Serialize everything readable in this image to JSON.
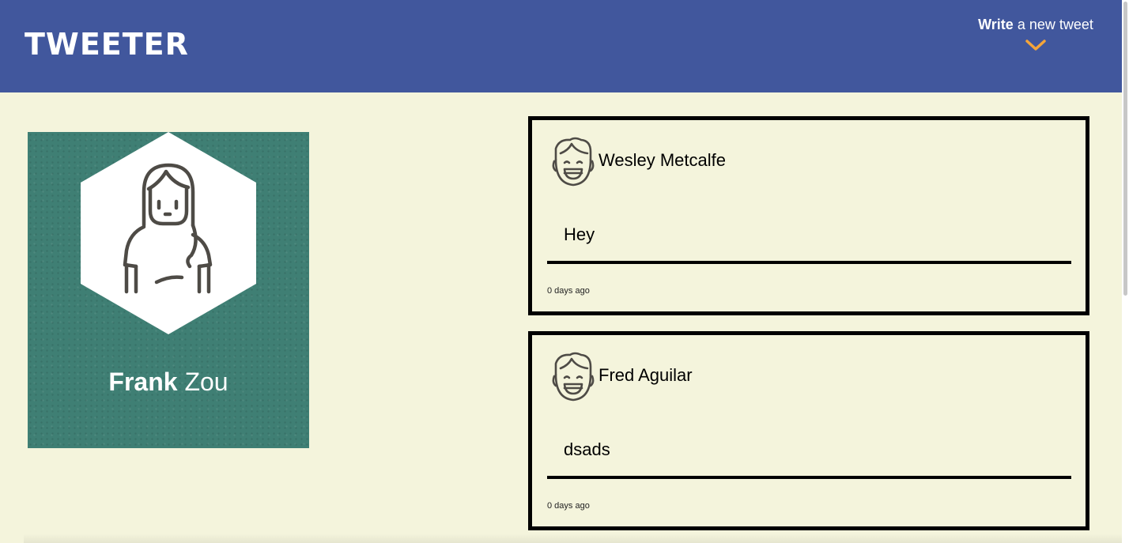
{
  "header": {
    "logo": "TWEETER",
    "compose_strong": "Write",
    "compose_rest": " a new tweet",
    "compose_icon": "chevron-down-icon"
  },
  "profile": {
    "first_name": "Frank",
    "last_name": " Zou",
    "avatar_icon": "user-avatar-icon"
  },
  "colors": {
    "nav": "#41579d",
    "page_bg": "#f4f4dc",
    "profile_bg": "#3f7f74",
    "accent": "#f5a53a"
  },
  "tweets": [
    {
      "author": "Wesley Metcalfe",
      "content": "Hey",
      "time": "0 days ago"
    },
    {
      "author": "Fred Aguilar",
      "content": "dsads",
      "time": "0 days ago"
    }
  ]
}
